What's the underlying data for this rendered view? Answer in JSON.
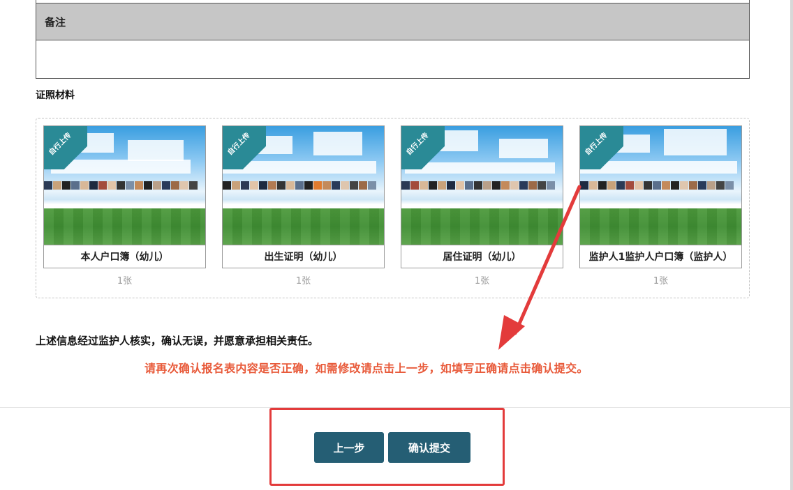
{
  "remarks": {
    "header": "备注",
    "value": ""
  },
  "documents": {
    "section_title": "证照材料",
    "ribbon_label": "自行上传",
    "items": [
      {
        "label": "本人户口簿（幼儿）",
        "count": "1张"
      },
      {
        "label": "出生证明（幼儿）",
        "count": "1张"
      },
      {
        "label": "居住证明（幼儿）",
        "count": "1张"
      },
      {
        "label": "监护人1监护人户口簿（监护人）",
        "count": "1张"
      }
    ]
  },
  "confirm_statement": "上述信息经过监护人核实，确认无误，并愿意承担相关责任。",
  "notice": "请再次确认报名表内容是否正确，如需修改请点击上一步，如填写正确请点击确认提交。",
  "buttons": {
    "prev_label": "上一步",
    "submit_label": "确认提交"
  },
  "colors": {
    "button_bg": "#255e74",
    "notice_red": "#e85a3a",
    "annotation_red": "#e33b3b",
    "ribbon_teal": "#2a8a96"
  }
}
